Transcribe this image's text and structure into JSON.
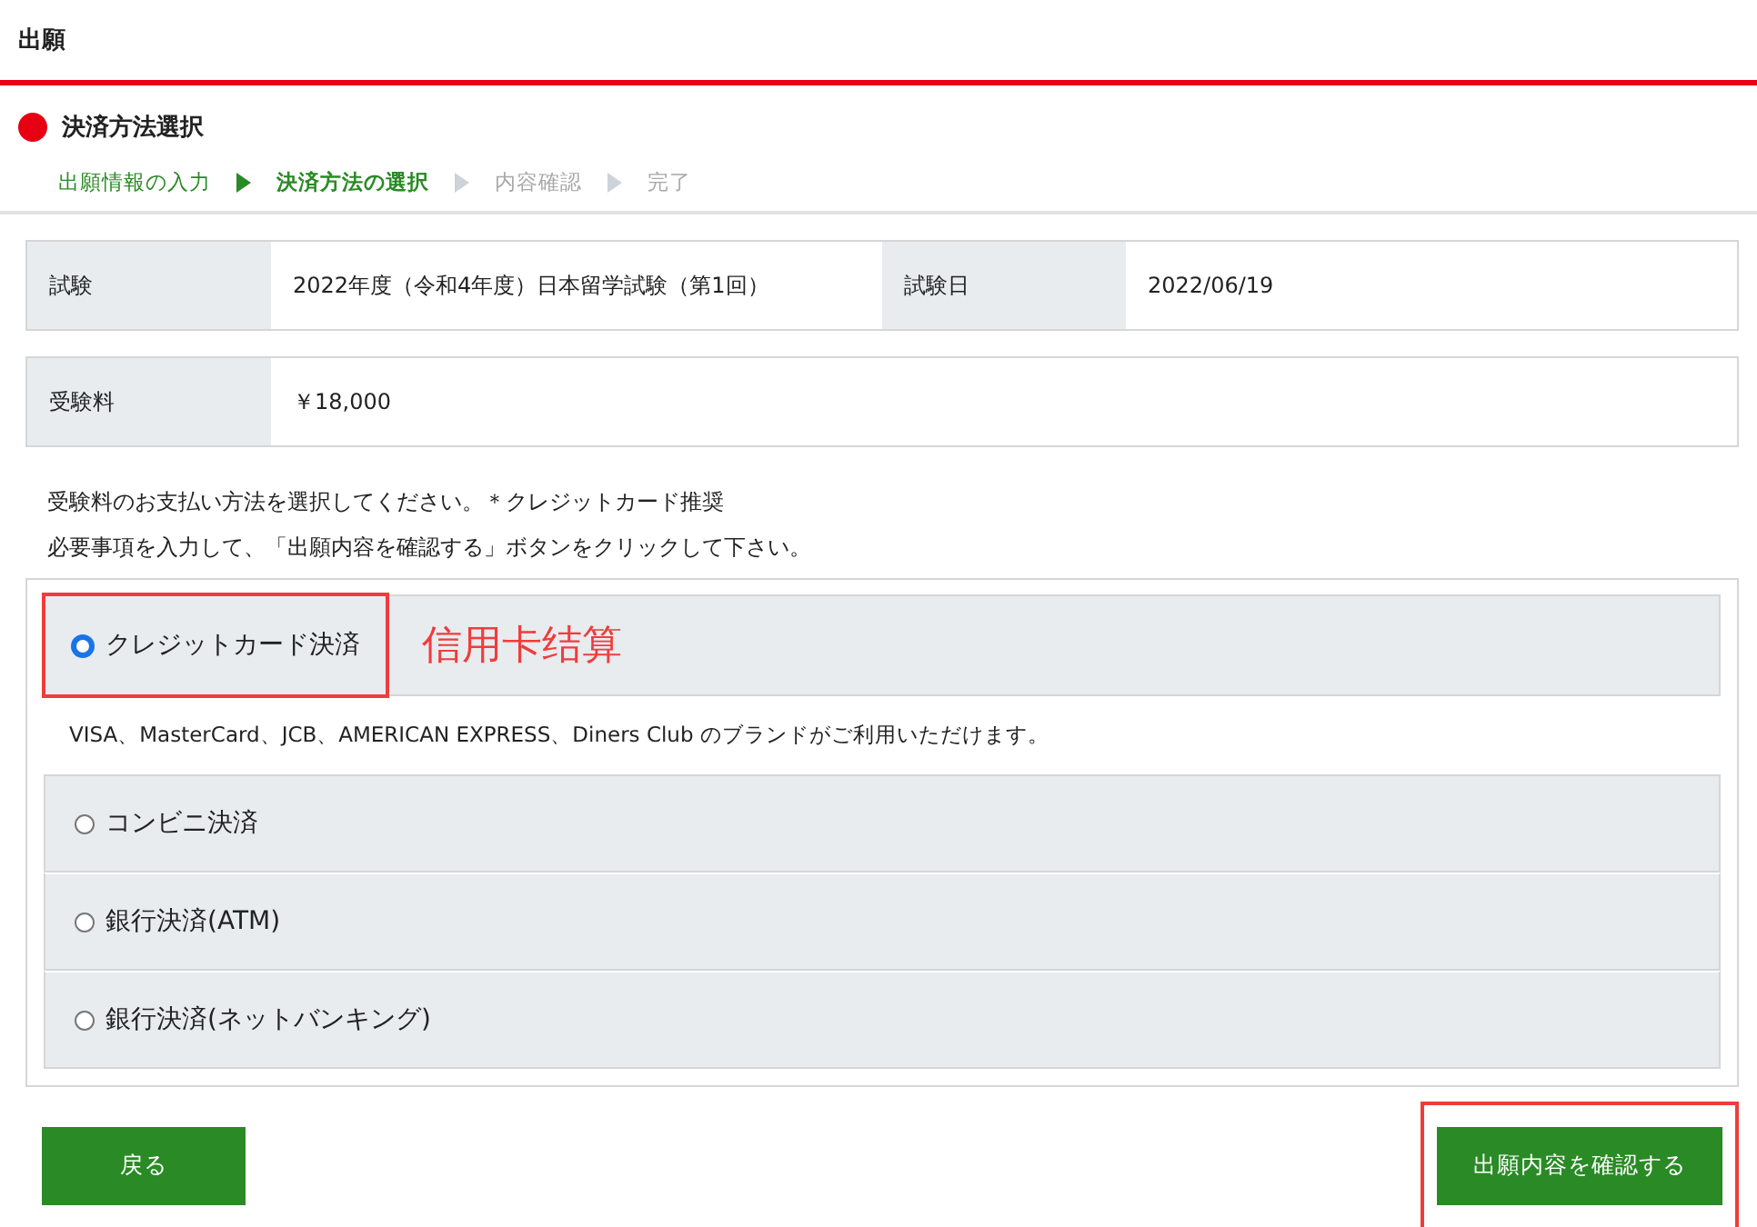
{
  "header": {
    "title": "出願"
  },
  "section": {
    "title": "決済方法選択"
  },
  "steps": [
    {
      "label": "出願情報の入力",
      "done": true,
      "selected": false
    },
    {
      "label": "決済方法の選択",
      "done": false,
      "selected": true
    },
    {
      "label": "内容確認",
      "done": false,
      "selected": false
    },
    {
      "label": "完了",
      "done": false,
      "selected": false
    }
  ],
  "info_rows": [
    [
      {
        "label": "試験",
        "value": "2022年度（令和4年度）日本留学試験（第1回）"
      },
      {
        "label": "試験日",
        "value": "2022/06/19"
      }
    ],
    [
      {
        "label": "受験料",
        "value": "￥18,000"
      }
    ]
  ],
  "instructions": [
    "受験料のお支払い方法を選択してください。＊クレジットカード推奨",
    "必要事項を入力して、「出願内容を確認する」ボタンをクリックして下さい。"
  ],
  "payment_options": [
    {
      "label": "クレジットカード決済",
      "selected": true,
      "highlighted": true,
      "annotation": "信用卡结算",
      "note": "VISA、MasterCard、JCB、AMERICAN EXPRESS、Diners Club のブランドがご利用いただけます。"
    },
    {
      "label": "コンビニ決済",
      "selected": false,
      "highlighted": false
    },
    {
      "label": "銀行決済(ATM)",
      "selected": false,
      "highlighted": false
    },
    {
      "label": "銀行決済(ネットバンキング)",
      "selected": false,
      "highlighted": false
    }
  ],
  "buttons": {
    "back": {
      "label": "戻る",
      "highlighted": false
    },
    "confirm": {
      "label": "出願内容を確認する",
      "highlighted": true
    }
  }
}
